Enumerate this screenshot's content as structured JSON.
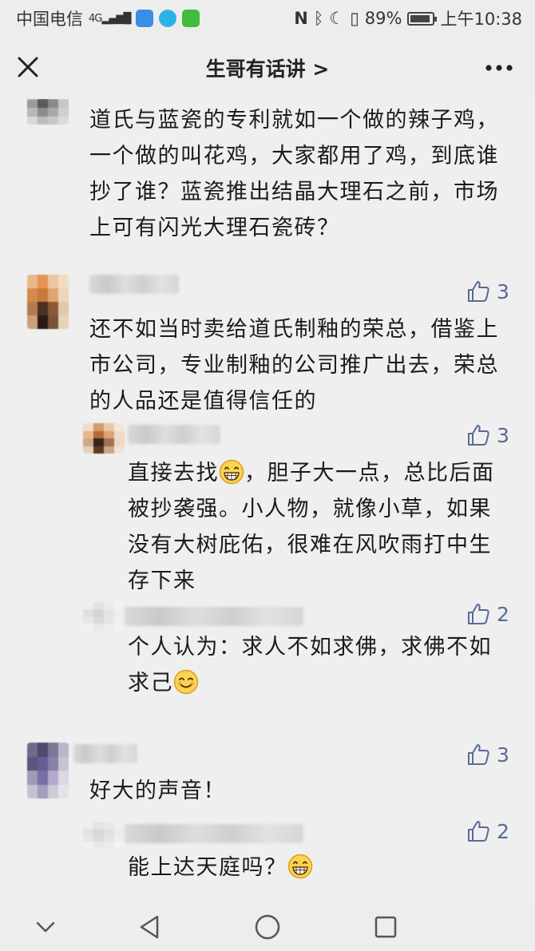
{
  "status_bar": {
    "carrier": "中国电信",
    "network": "4G",
    "battery": "89%",
    "time": "上午10:38"
  },
  "header": {
    "title": "生哥有话讲 >",
    "close_icon": "close-icon",
    "more_icon": "more-dots-icon"
  },
  "colors": {
    "like_blue": "#576b95",
    "background": "#efefef"
  },
  "comments": [
    {
      "text": "道氏与蓝瓷的专利就如一个做的辣子鸡，一个做的叫花鸡，大家都用了鸡，到底谁抄了谁？蓝瓷推出结晶大理石之前，市场上可有闪光大理石瓷砖？"
    },
    {
      "likes": "3",
      "text": "还不如当时卖给道氏制釉的荣总，借鉴上市公司，专业制釉的公司推广出去，荣总的人品还是值得信任的",
      "replies": [
        {
          "likes": "3",
          "text_before": "直接去找",
          "emoji": "grin-emoji",
          "text_after": "，胆子大一点，总比后面被抄袭强。小人物，就像小草，如果没有大树庇佑，很难在风吹雨打中生存下来"
        },
        {
          "likes": "2",
          "text_before": "个人认为：求人不如求佛，求佛不如求己",
          "emoji": "smile-emoji"
        }
      ]
    },
    {
      "likes": "3",
      "text": "好大的声音！",
      "replies": [
        {
          "likes": "2",
          "text_before": "能上达天庭吗？",
          "emoji": "grin-emoji"
        }
      ]
    }
  ],
  "nav_bar": {
    "icons": [
      "chevron-down-icon",
      "back-triangle-icon",
      "home-circle-icon",
      "recents-square-icon"
    ]
  }
}
